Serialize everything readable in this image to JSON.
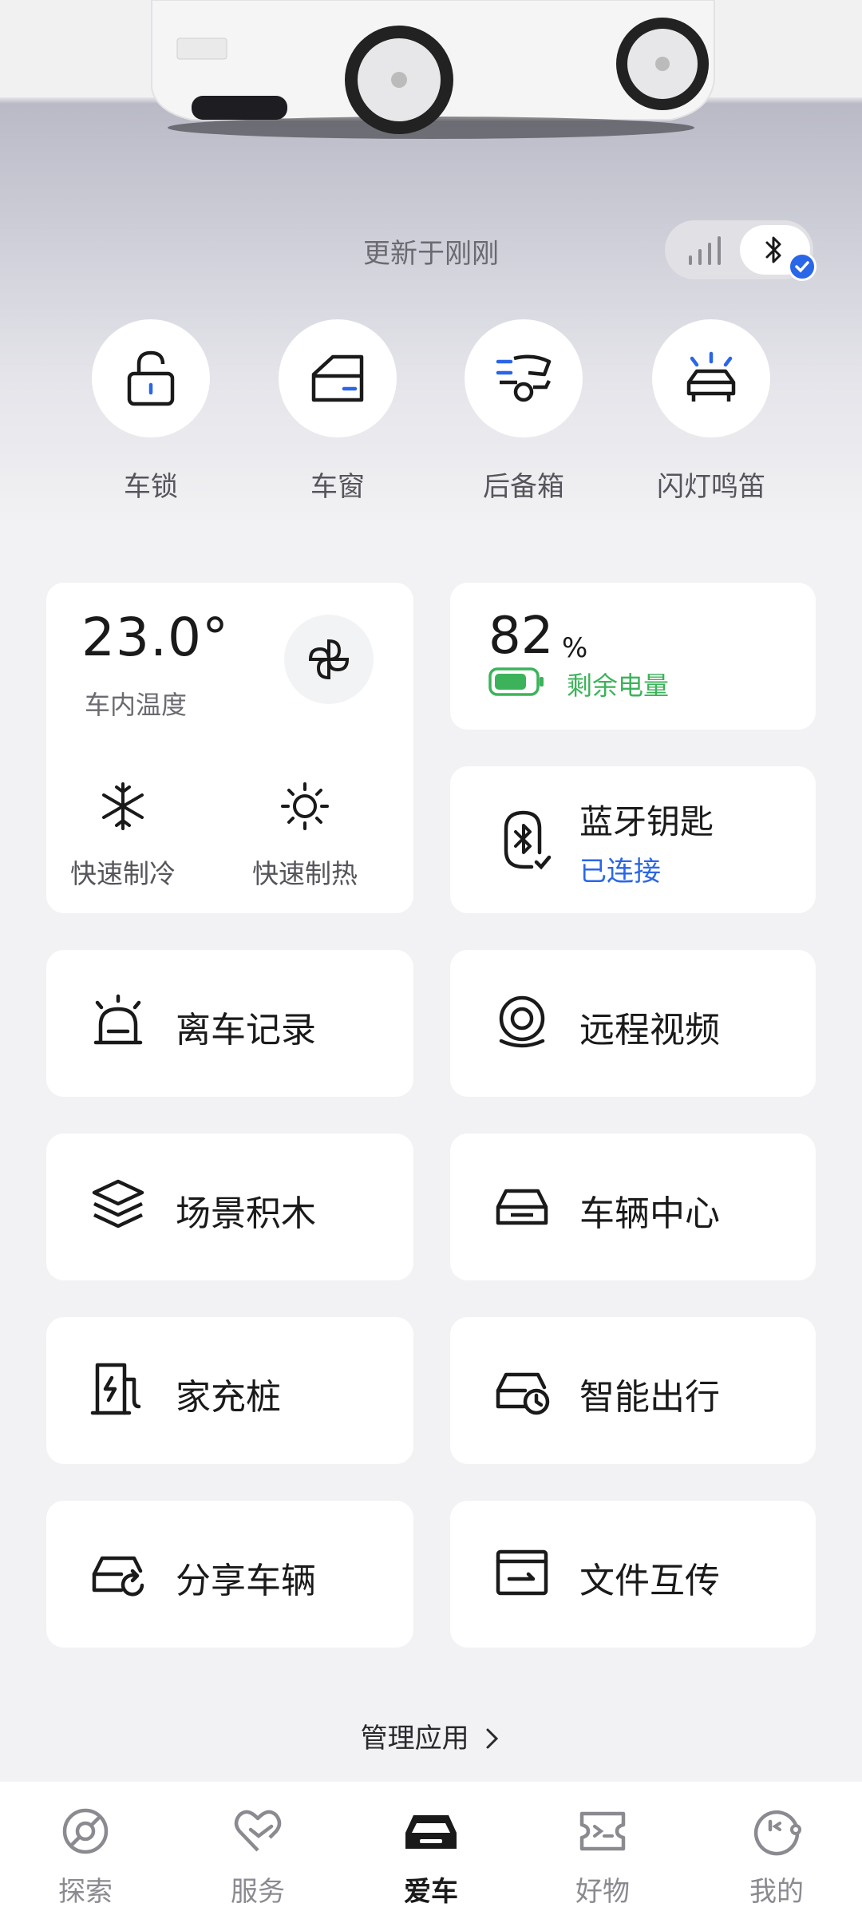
{
  "header": {
    "update_text": "更新于刚刚"
  },
  "connection": {
    "signal_icon": "signal-bars-icon",
    "bluetooth_icon": "bluetooth-icon",
    "bluetooth_active": true
  },
  "quick_actions": [
    {
      "label": "车锁",
      "icon": "lock-icon"
    },
    {
      "label": "车窗",
      "icon": "car-window-icon"
    },
    {
      "label": "后备箱",
      "icon": "trunk-icon"
    },
    {
      "label": "闪灯鸣笛",
      "icon": "flash-horn-icon"
    }
  ],
  "climate": {
    "temperature": "23.0°",
    "temperature_label": "车内温度",
    "cool_label": "快速制冷",
    "heat_label": "快速制热"
  },
  "battery": {
    "value": "82",
    "unit": "%",
    "label": "剩余电量",
    "level": 0.82,
    "color": "#3cb35a"
  },
  "bluetooth_key": {
    "title": "蓝牙钥匙",
    "status": "已连接",
    "status_color": "#2a66e8"
  },
  "tiles": [
    {
      "label": "离车记录",
      "icon": "alarm-bell-icon"
    },
    {
      "label": "远程视频",
      "icon": "camera-icon"
    },
    {
      "label": "场景积木",
      "icon": "layers-icon"
    },
    {
      "label": "车辆中心",
      "icon": "car-icon"
    },
    {
      "label": "家充桩",
      "icon": "charger-icon"
    },
    {
      "label": "智能出行",
      "icon": "car-clock-icon"
    },
    {
      "label": "分享车辆",
      "icon": "car-share-icon"
    },
    {
      "label": "文件互传",
      "icon": "file-transfer-icon"
    }
  ],
  "manage_apps": "管理应用",
  "tabbar": {
    "tabs": [
      {
        "label": "探索",
        "icon": "compass-icon"
      },
      {
        "label": "服务",
        "icon": "heart-hand-icon"
      },
      {
        "label": "爱车",
        "icon": "car-front-icon",
        "active": true
      },
      {
        "label": "好物",
        "icon": "ticket-icon"
      },
      {
        "label": "我的",
        "icon": "profile-icon"
      }
    ]
  },
  "colors": {
    "accent_blue": "#2a66e8",
    "battery_green": "#3cb35a",
    "background": "#f2f2f4"
  }
}
